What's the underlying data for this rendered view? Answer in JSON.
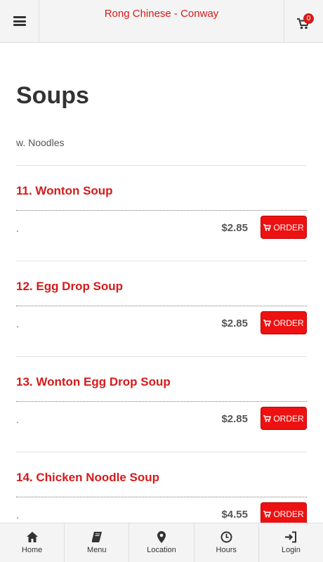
{
  "header": {
    "title": "Rong Chinese - Conway",
    "cart_count": "0"
  },
  "section": {
    "title": "Soups",
    "subtitle": "w. Noodles"
  },
  "order_label": "ORDER",
  "items": [
    {
      "name": "11. Wonton Soup",
      "desc": ".",
      "price": "$2.85"
    },
    {
      "name": "12. Egg Drop Soup",
      "desc": ".",
      "price": "$2.85"
    },
    {
      "name": "13. Wonton Egg Drop Soup",
      "desc": ".",
      "price": "$2.85"
    },
    {
      "name": "14. Chicken Noodle Soup",
      "desc": ".",
      "price": "$4.55"
    }
  ],
  "nav": [
    {
      "label": "Home",
      "icon": "home-icon"
    },
    {
      "label": "Menu",
      "icon": "book-icon"
    },
    {
      "label": "Location",
      "icon": "map-marker-icon"
    },
    {
      "label": "Hours",
      "icon": "clock-icon"
    },
    {
      "label": "Login",
      "icon": "sign-in-icon"
    }
  ],
  "colors": {
    "accent": "#d61a1a",
    "button": "#ee1111"
  }
}
